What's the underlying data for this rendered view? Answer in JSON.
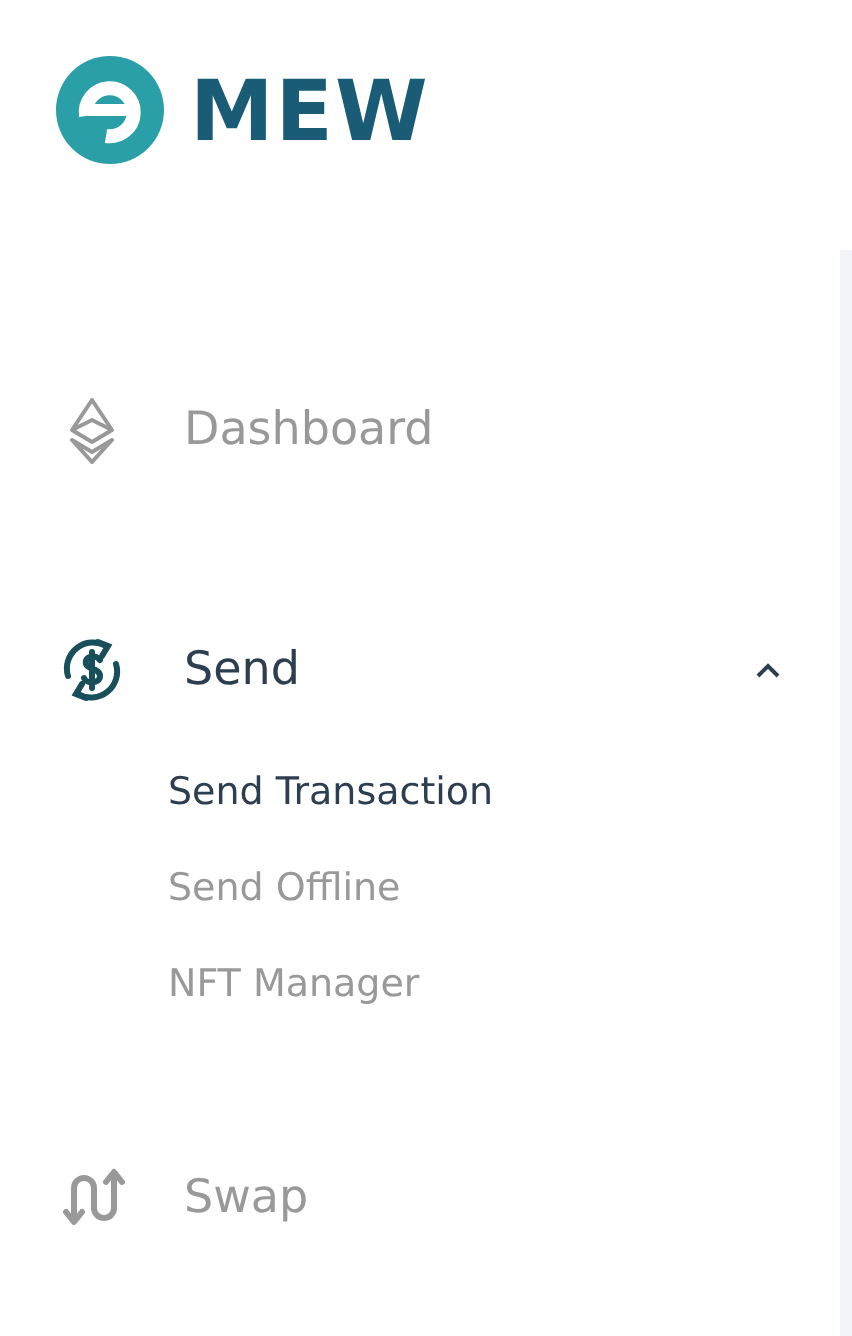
{
  "logo": {
    "text": "MEW"
  },
  "nav": [
    {
      "kind": "dashboard",
      "label": "Dashboard",
      "selected": false
    },
    {
      "kind": "send",
      "label": "Send",
      "selected": true,
      "expanded": true,
      "children": [
        {
          "label": "Send Transaction",
          "selected": true
        },
        {
          "label": "Send Offline",
          "selected": false
        },
        {
          "label": "NFT Manager",
          "selected": false
        }
      ]
    },
    {
      "kind": "swap",
      "label": "Swap",
      "selected": false
    }
  ]
}
